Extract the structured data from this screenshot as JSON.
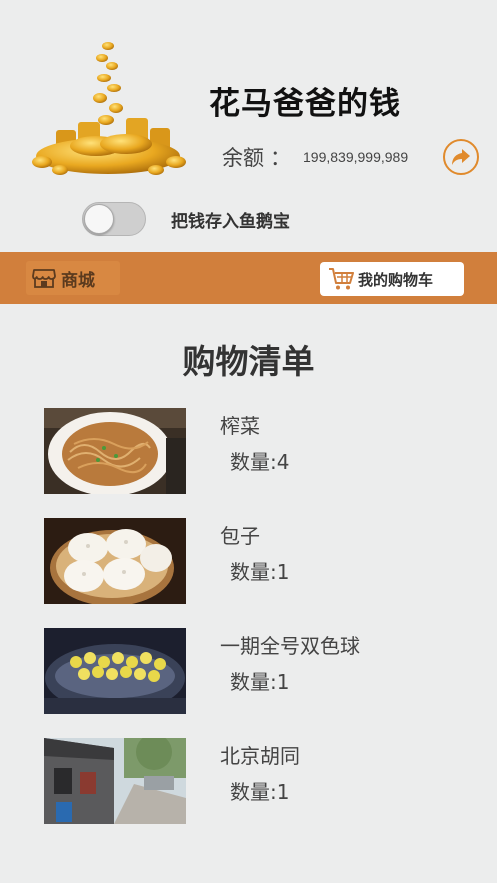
{
  "header": {
    "title": "花马爸爸的钱",
    "balance_label": "余额",
    "balance_colon": "：",
    "balance_value": "199,839,999,989"
  },
  "toggle": {
    "label": "把钱存入鱼鹅宝",
    "on": false
  },
  "nav": {
    "shop_label": "商城",
    "cart_label": "我的购物车"
  },
  "list": {
    "title": "购物清单",
    "items": [
      {
        "name": "榨菜",
        "qty": "数量:4",
        "image": "noodles"
      },
      {
        "name": "包子",
        "qty": "数量:1",
        "image": "steamed-buns"
      },
      {
        "name": "一期全号双色球",
        "qty": "数量:1",
        "image": "lottery-balls"
      },
      {
        "name": "北京胡同",
        "qty": "数量:1",
        "image": "hutong-street"
      }
    ]
  },
  "colors": {
    "accent": "#d17f3c",
    "background": "#eceded",
    "share_icon": "#e08a2c"
  }
}
